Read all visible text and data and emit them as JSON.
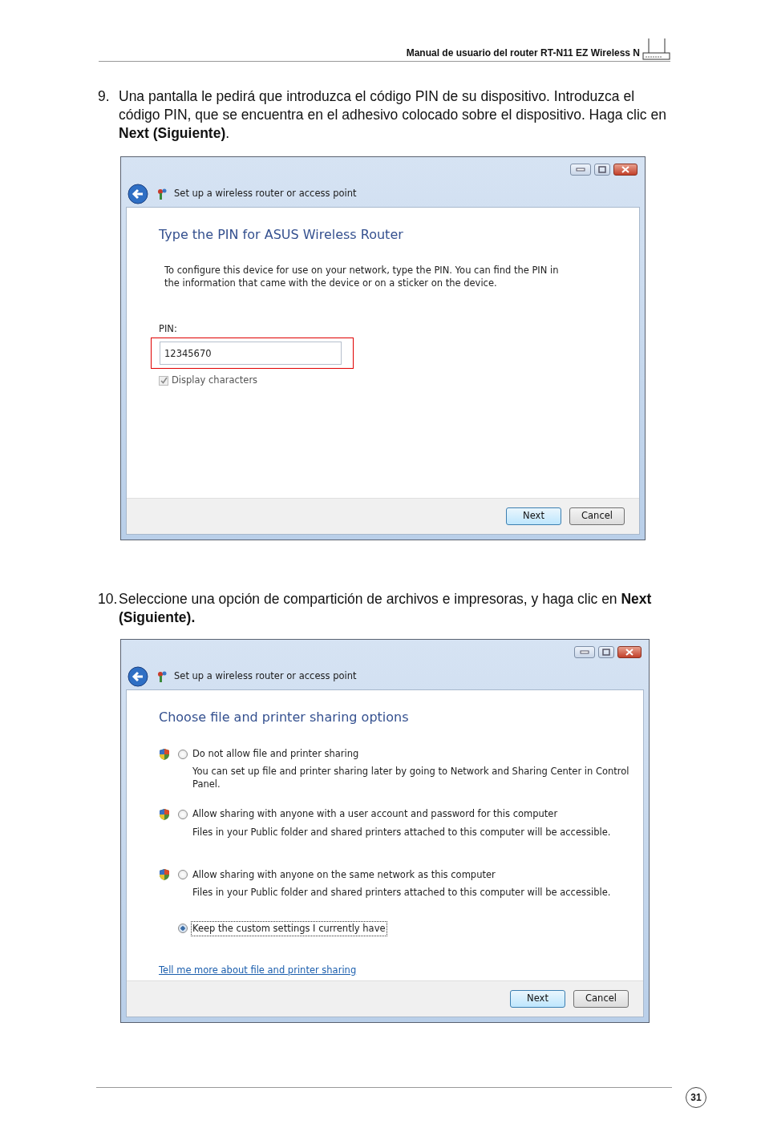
{
  "header": {
    "title": "Manual de usuario del router RT-N11 EZ Wireless N"
  },
  "steps": [
    {
      "number": "9.",
      "text": "Una pantalla le pedirá que introduzca el código PIN de su dispositivo. Introduzca el código PIN, que se encuentra en el adhesivo colocado sobre el dispositivo. Haga clic en **Next (Siguiente)**.",
      "dialog": {
        "kind": "pin",
        "title": "Set up a wireless router or access point",
        "heading": "Type the PIN for ASUS Wireless Router",
        "description": "To configure this device for use on your network, type the PIN. You can find the PIN in the information that came with the device or on a sticker on the device.",
        "pin_label": "PIN:",
        "pin_value": "12345670",
        "pin_highlighted": true,
        "checkbox": {
          "label": "Display characters",
          "checked": true,
          "disabled": true
        },
        "buttons": [
          {
            "label": "Next",
            "default": true
          },
          {
            "label": "Cancel",
            "default": false
          }
        ]
      }
    },
    {
      "number": "10.",
      "text": "Seleccione una opción de compartición de archivos e impresoras, y haga clic en **Next (Siguiente).**",
      "dialog": {
        "kind": "sharing",
        "title": "Set up a wireless router or access point",
        "heading": "Choose file and printer sharing options",
        "options": [
          {
            "label": "Do not allow file and printer sharing",
            "description": "You can set up file and printer sharing later by going to Network and Sharing Center in Control Panel.",
            "shield": true,
            "selected": false,
            "focused": false
          },
          {
            "label": "Allow sharing with anyone with a user account and password for this computer",
            "description": "Files in your Public folder and shared printers attached to this computer will be accessible.",
            "shield": true,
            "selected": false,
            "focused": false
          },
          {
            "label": "Allow sharing with anyone on the same network as this computer",
            "description": "Files in your Public folder and shared printers attached to this computer will be accessible.",
            "shield": true,
            "selected": false,
            "focused": false
          },
          {
            "label": "Keep the custom settings I currently have",
            "shield": false,
            "selected": true,
            "focused": true
          }
        ],
        "link": "Tell me more about file and printer sharing",
        "buttons": [
          {
            "label": "Next",
            "default": true
          },
          {
            "label": "Cancel",
            "default": false
          }
        ]
      }
    }
  ],
  "footer": {
    "page_number": "31"
  }
}
